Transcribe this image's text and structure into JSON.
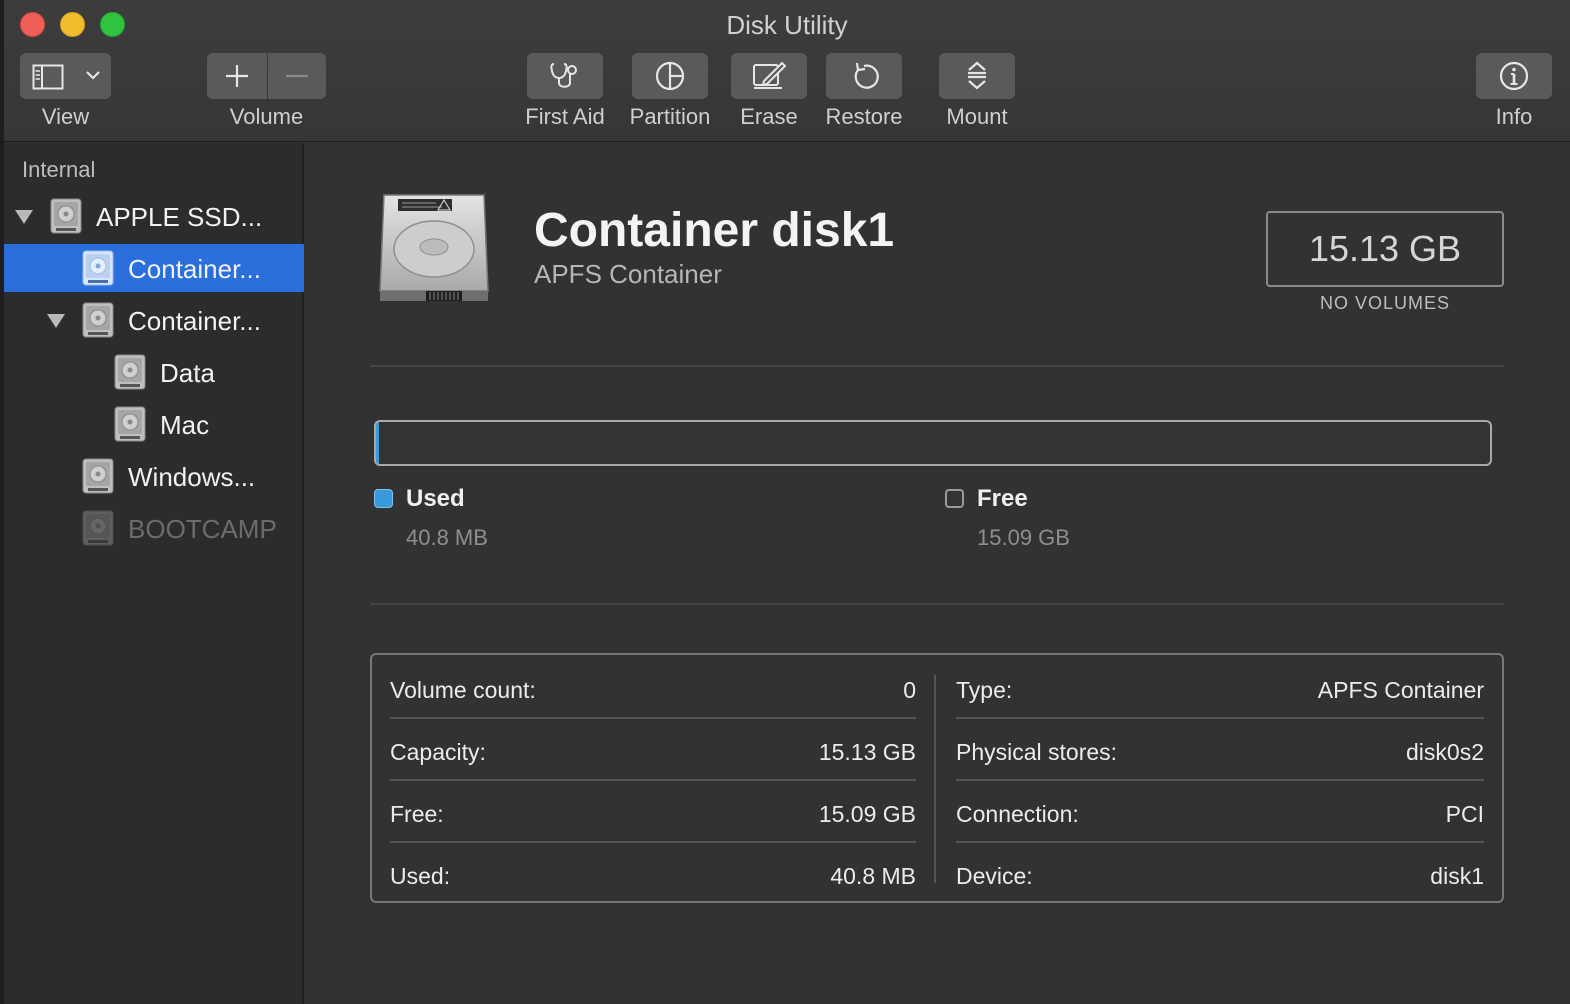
{
  "window": {
    "title": "Disk Utility"
  },
  "toolbar": {
    "view_label": "View",
    "volume_label": "Volume",
    "first_aid_label": "First Aid",
    "partition_label": "Partition",
    "erase_label": "Erase",
    "restore_label": "Restore",
    "mount_label": "Mount",
    "info_label": "Info"
  },
  "sidebar": {
    "section": "Internal",
    "items": [
      {
        "label": "APPLE SSD...",
        "level": 0,
        "expanded": true,
        "selected": false,
        "dimmed": false
      },
      {
        "label": "Container...",
        "level": 1,
        "selected": true,
        "dimmed": false
      },
      {
        "label": "Container...",
        "level": 1,
        "expanded": true,
        "selected": false,
        "dimmed": false
      },
      {
        "label": "Data",
        "level": 2,
        "selected": false,
        "dimmed": false
      },
      {
        "label": "Mac",
        "level": 2,
        "selected": false,
        "dimmed": false
      },
      {
        "label": "Windows...",
        "level": 1,
        "selected": false,
        "dimmed": false
      },
      {
        "label": "BOOTCAMP",
        "level": 1,
        "selected": false,
        "dimmed": true
      }
    ]
  },
  "detail": {
    "title": "Container disk1",
    "subtitle": "APFS Container",
    "size": "15.13 GB",
    "volumes_note": "NO VOLUMES",
    "usage": {
      "used_fraction": 0.0027,
      "used_color": "#3a9ad9",
      "used_label": "Used",
      "used_value": "40.8 MB",
      "free_label": "Free",
      "free_value": "15.09 GB"
    },
    "info_left": [
      {
        "key": "Volume count:",
        "value": "0"
      },
      {
        "key": "Capacity:",
        "value": "15.13 GB"
      },
      {
        "key": "Free:",
        "value": "15.09 GB"
      },
      {
        "key": "Used:",
        "value": "40.8 MB"
      }
    ],
    "info_right": [
      {
        "key": "Type:",
        "value": "APFS Container"
      },
      {
        "key": "Physical stores:",
        "value": "disk0s2"
      },
      {
        "key": "Connection:",
        "value": "PCI"
      },
      {
        "key": "Device:",
        "value": "disk1"
      }
    ]
  },
  "colors": {
    "accent": "#2a6fdb",
    "used": "#3a9ad9"
  }
}
